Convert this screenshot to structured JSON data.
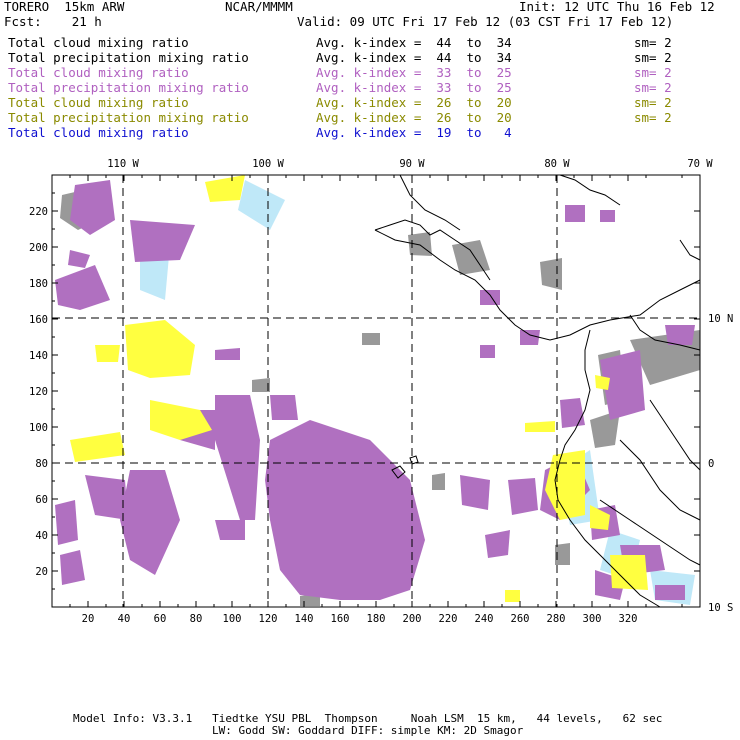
{
  "header": {
    "model": "TORERO  15km ARW",
    "org": "NCAR/MMMM",
    "init": "Init: 12 UTC Thu 16 Feb 12",
    "fcst": "Fcst:    21 h",
    "valid": "Valid: 09 UTC Fri 17 Feb 12 (03 CST Fri 17 Feb 12)"
  },
  "legend": [
    {
      "field": "Total cloud mixing ratio",
      "kidx": "Avg. k-index =  44  to  34",
      "sm": "sm= 2",
      "color": "#000000"
    },
    {
      "field": "Total precipitation mixing ratio",
      "kidx": "Avg. k-index =  44  to  34",
      "sm": "sm= 2",
      "color": "#000000"
    },
    {
      "field": "Total cloud mixing ratio",
      "kidx": "Avg. k-index =  33  to  25",
      "sm": "sm= 2",
      "color": "#b060c0"
    },
    {
      "field": "Total precipitation mixing ratio",
      "kidx": "Avg. k-index =  33  to  25",
      "sm": "sm= 2",
      "color": "#b060c0"
    },
    {
      "field": "Total cloud mixing ratio",
      "kidx": "Avg. k-index =  26  to  20",
      "sm": "sm= 2",
      "color": "#8a8a00"
    },
    {
      "field": "Total precipitation mixing ratio",
      "kidx": "Avg. k-index =  26  to  20",
      "sm": "sm= 2",
      "color": "#8a8a00"
    },
    {
      "field": "Total cloud mixing ratio",
      "kidx": "Avg. k-index =  19  to   4",
      "sm": "",
      "color": "#1010d0"
    }
  ],
  "axes": {
    "top_lon": [
      "110 W",
      "100 W",
      "90 W",
      "80 W",
      "70 W"
    ],
    "right_lat": [
      "10 N",
      "0",
      "10 S"
    ],
    "x_ticks": [
      "20",
      "40",
      "60",
      "80",
      "100",
      "120",
      "140",
      "160",
      "180",
      "200",
      "220",
      "240",
      "260",
      "280",
      "300",
      "320"
    ],
    "y_ticks": [
      "220",
      "200",
      "180",
      "160",
      "140",
      "120",
      "100",
      "80",
      "60",
      "40",
      "20"
    ]
  },
  "colors": {
    "gray": "#999999",
    "violet": "#b070c0",
    "yellow": "#ffff40",
    "lightblue": "#bfe8f8"
  },
  "footer": {
    "line1": "Model Info: V3.3.1   Tiedtke YSU PBL  Thompson     Noah LSM  15 km,   44 levels,   62 sec",
    "line2": "LW: Godd SW: Goddard DIFF: simple KM: 2D Smagor"
  }
}
